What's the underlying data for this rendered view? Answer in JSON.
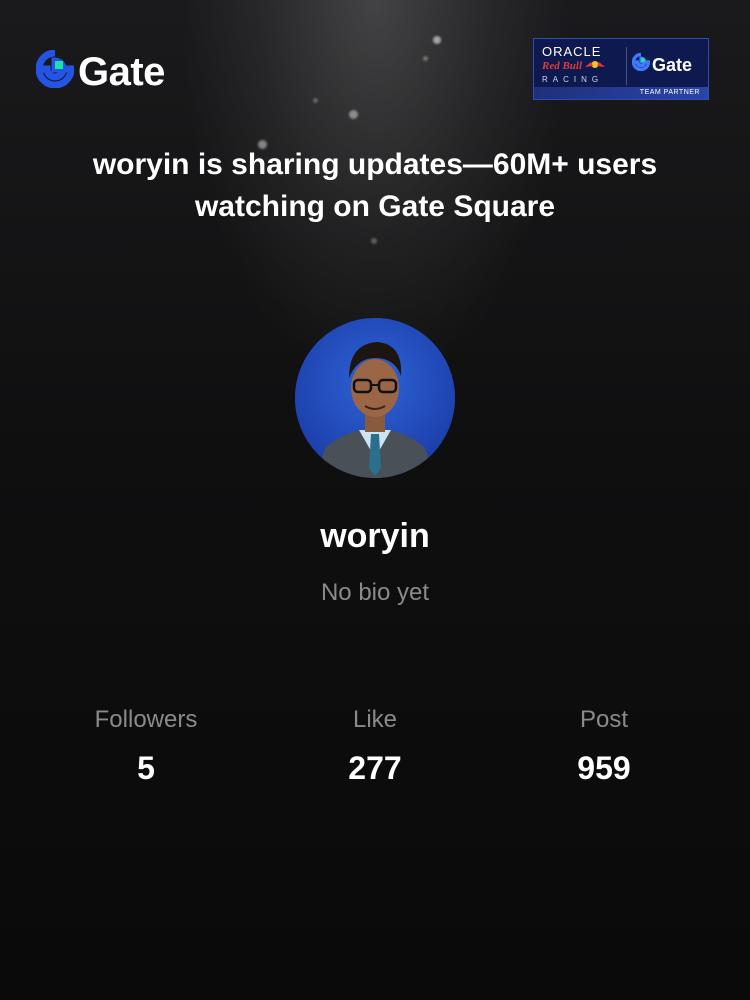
{
  "brand": {
    "logo_icon": "gate-logo-icon",
    "wordmark": "Gate",
    "accent_blue": "#2354e6",
    "accent_green": "#17e6a1"
  },
  "partner_badge": {
    "line1": "ORACLE",
    "line2": "Red Bull",
    "line3": "RACING",
    "partner_wordmark": "Gate",
    "strip_text": "TEAM PARTNER"
  },
  "headline": "woryin is sharing updates—60M+ users watching on Gate Square",
  "profile": {
    "username": "woryin",
    "bio": "No bio yet",
    "avatar_icon": "avatar-portrait"
  },
  "stats": [
    {
      "label": "Followers",
      "value": "5"
    },
    {
      "label": "Like",
      "value": "277"
    },
    {
      "label": "Post",
      "value": "959"
    }
  ]
}
